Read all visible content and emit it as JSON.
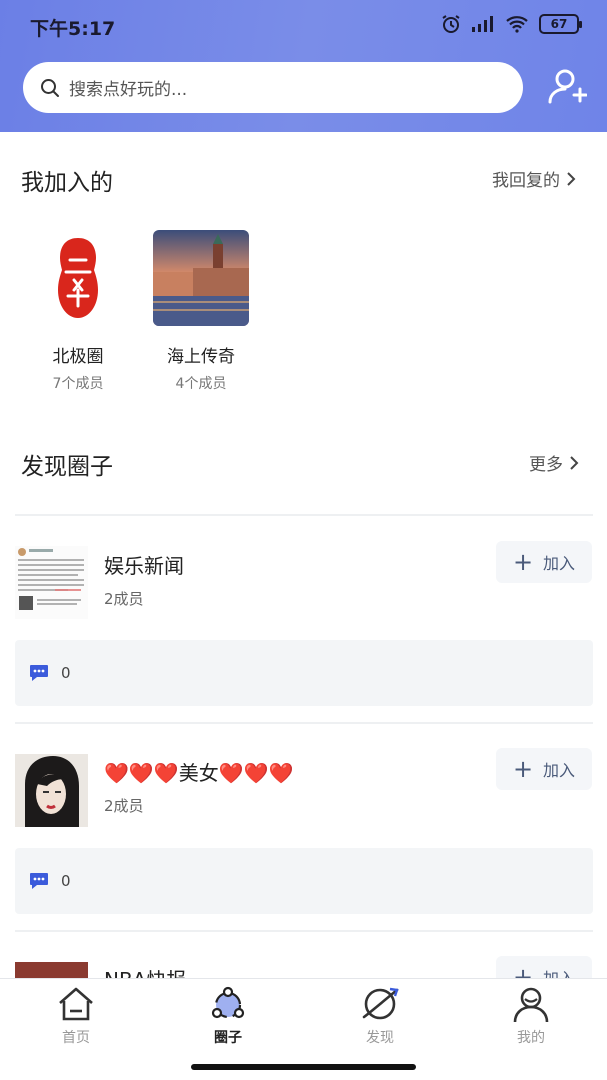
{
  "status": {
    "time": "下午5:17",
    "battery": "67"
  },
  "search": {
    "placeholder": "搜索点好玩的..."
  },
  "joined_section": {
    "title": "我加入的",
    "link": "我回复的"
  },
  "joined": [
    {
      "name": "北极圈",
      "members": "7个成员"
    },
    {
      "name": "海上传奇",
      "members": "4个成员"
    }
  ],
  "discover_section": {
    "title": "发现圈子",
    "link": "更多"
  },
  "circles": [
    {
      "name": "娱乐新闻",
      "members": "2成员",
      "join_label": "加入",
      "comments": "0"
    },
    {
      "name": "❤️❤️❤️美女❤️❤️❤️",
      "members": "2成员",
      "join_label": "加入",
      "comments": "0"
    },
    {
      "name": "NBA快报",
      "members": "",
      "join_label": "加入",
      "comments": ""
    }
  ],
  "tabs": [
    {
      "label": "首页",
      "icon": "home-icon"
    },
    {
      "label": "圈子",
      "icon": "circle-network-icon"
    },
    {
      "label": "发现",
      "icon": "planet-icon"
    },
    {
      "label": "我的",
      "icon": "profile-icon"
    }
  ],
  "colors": {
    "header": "#6b7fe6",
    "accent": "#3b5bdb",
    "seal_red": "#d9261c"
  }
}
